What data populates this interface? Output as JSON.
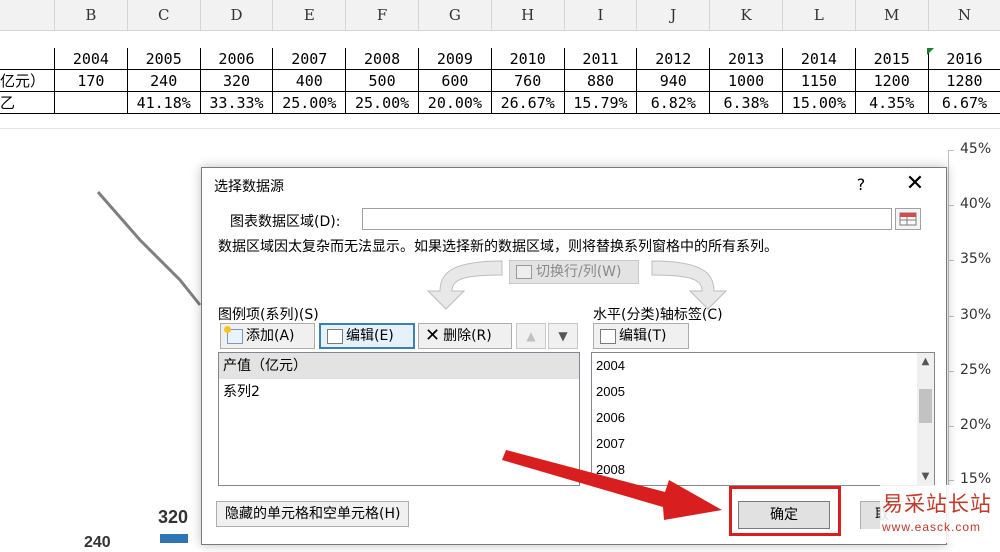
{
  "sheet": {
    "columns": [
      "B",
      "C",
      "D",
      "E",
      "F",
      "G",
      "H",
      "I",
      "J",
      "K",
      "L",
      "M",
      "N"
    ],
    "row_year": [
      "2004",
      "2005",
      "2006",
      "2007",
      "2008",
      "2009",
      "2010",
      "2011",
      "2012",
      "2013",
      "2014",
      "2015",
      "2016"
    ],
    "row_value_label": "亿元）",
    "row_value": [
      "170",
      "240",
      "320",
      "400",
      "500",
      "600",
      "760",
      "880",
      "940",
      "1000",
      "1150",
      "1200",
      "1280"
    ],
    "row_rate_label": "乙",
    "row_rate": [
      "",
      "41.18%",
      "33.33%",
      "25.00%",
      "25.00%",
      "20.00%",
      "26.67%",
      "15.79%",
      "6.82%",
      "6.38%",
      "15.00%",
      "4.35%",
      "6.67%"
    ]
  },
  "chart_bg": {
    "y_labels": [
      "45%",
      "40%",
      "35%",
      "30%",
      "25%",
      "20%",
      "15%"
    ],
    "num_320": "320",
    "num_240": "240",
    "series_color": "#2e75b6",
    "line_color": "#7f7f7f"
  },
  "dialog": {
    "title": "选择数据源",
    "help_label": "?",
    "close_label": "✕",
    "range_label": "图表数据区域(D):",
    "range_value": "",
    "warning": "数据区域因太复杂而无法显示。如果选择新的数据区域，则将替换系列窗格中的所有系列。",
    "switch_label": "切换行/列(W)",
    "legend_group_label": "图例项(系列)(S)",
    "add_label": "添加(A)",
    "edit_label": "编辑(E)",
    "delete_label": "删除(R)",
    "up_label": "▲",
    "down_label": "▼",
    "series": [
      "产值（亿元）",
      "系列2"
    ],
    "axis_group_label": "水平(分类)轴标签(C)",
    "axis_edit_label": "编辑(T)",
    "categories": [
      "2004",
      "2005",
      "2006",
      "2007",
      "2008"
    ],
    "hidden_cells_label": "隐藏的单元格和空单元格(H)",
    "ok_label": "确定",
    "cancel_label": "取",
    "accent_color": "#d81e1e"
  },
  "watermark": {
    "text": "易采站长站",
    "url": "www.easck.com"
  }
}
